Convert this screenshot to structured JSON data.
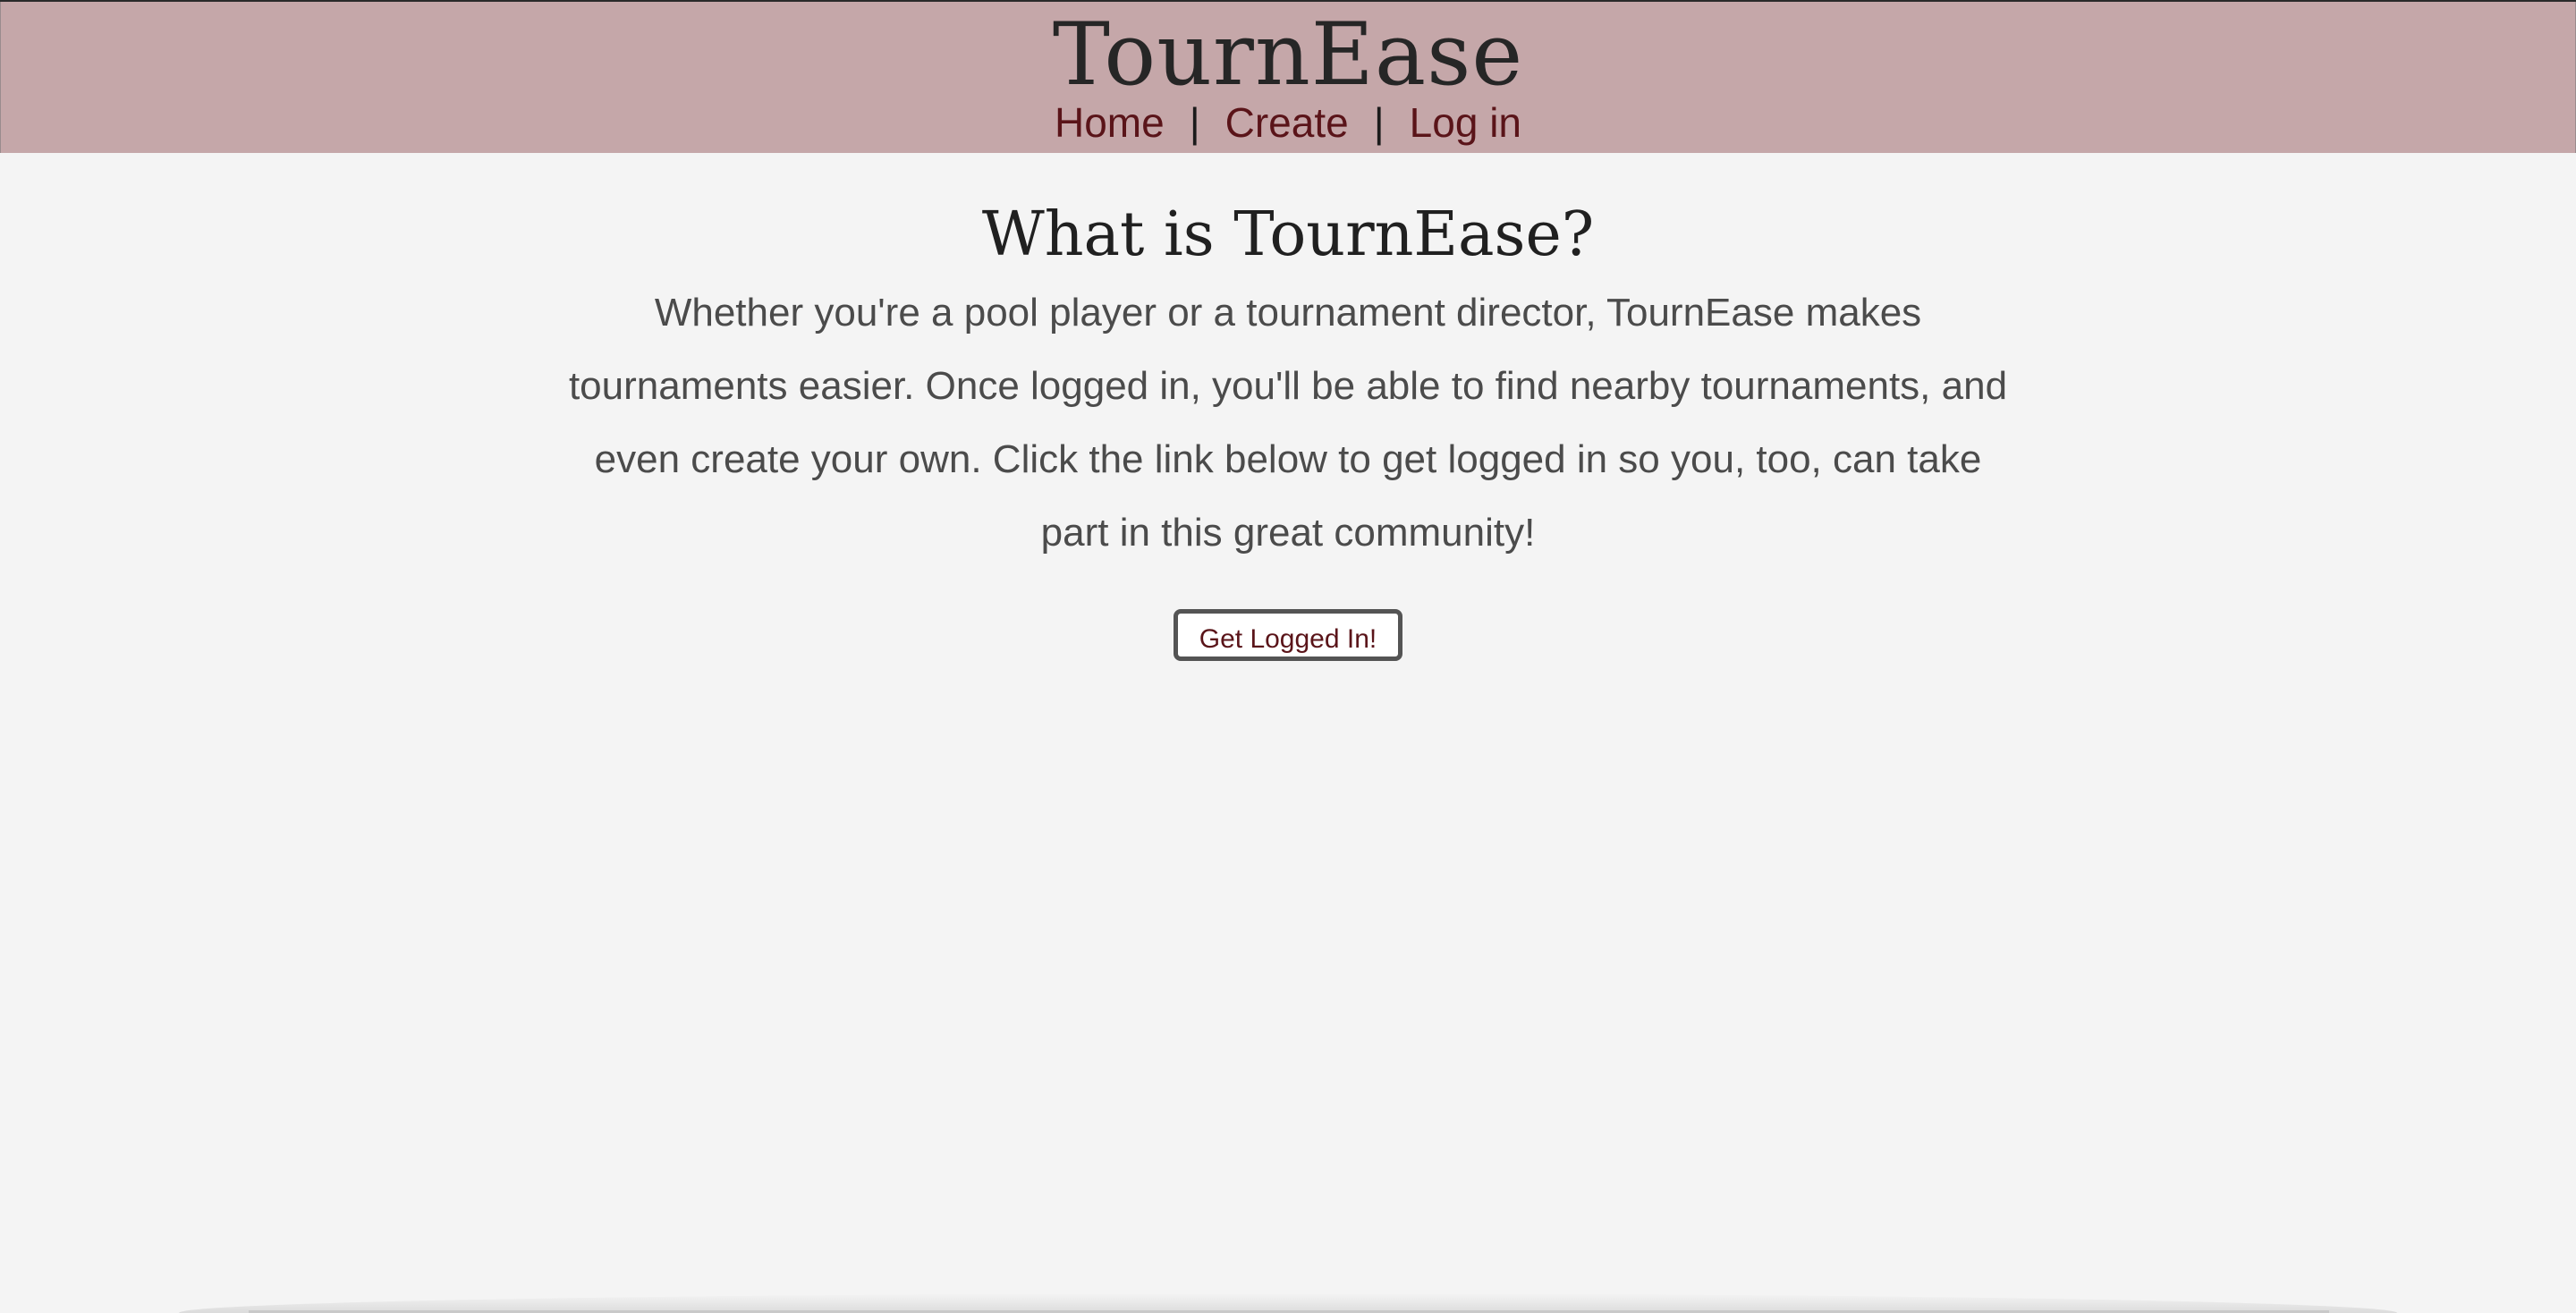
{
  "header": {
    "site_title": "TournEase",
    "nav": {
      "home": "Home",
      "separator": "|",
      "create": "Create",
      "login": "Log in"
    }
  },
  "main": {
    "heading": "What is TournEase?",
    "intro": "Whether you're a pool player or a tournament director, TournEase makes tournaments easier. Once logged in, you'll be able to find nearby tournaments, and even create your own. Click the link below to get logged in so you, too, can take part in this great community!",
    "cta_label": "Get Logged In!"
  },
  "colors": {
    "header_bg": "#c5a7a9",
    "page_bg": "#f4f4f4",
    "link": "#5a1419",
    "body_text": "#4b4b4b"
  }
}
